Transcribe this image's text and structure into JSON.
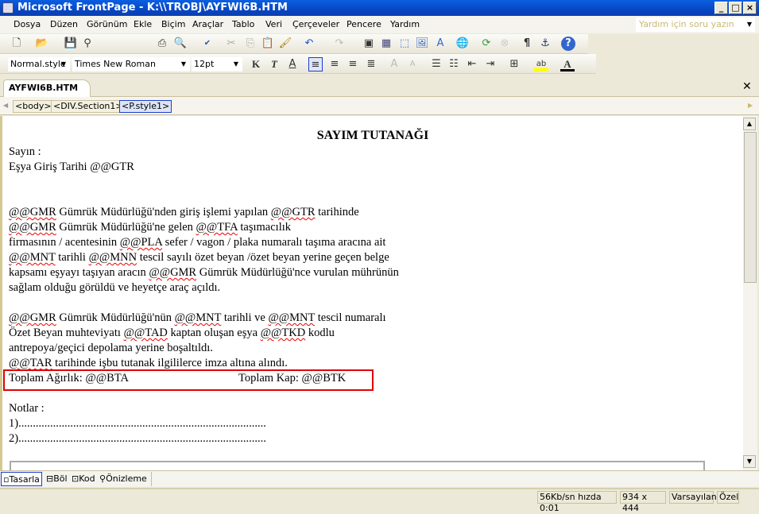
{
  "window": {
    "title": "Microsoft FrontPage - K:\\\\TROBJ\\AYFWI6B.HTM"
  },
  "menu": [
    "Dosya",
    "Düzen",
    "Görünüm",
    "Ekle",
    "Biçim",
    "Araçlar",
    "Tablo",
    "Veri",
    "Çerçeveler",
    "Pencere",
    "Yardım"
  ],
  "help_placeholder": "Yardım için soru yazın",
  "format": {
    "style": "Normal.style",
    "font": "Times New Roman",
    "size": "12pt"
  },
  "tab": {
    "label": "AYFWI6B.HTM"
  },
  "breadcrumb": [
    "<body>",
    "<DIV.Section1>",
    "<P.style1>"
  ],
  "doc": {
    "title": "SAYIM TUTANAĞI",
    "lines": [
      "Sayın :",
      "Eşya Giriş Tarihi @@GTR"
    ],
    "para1": [
      [
        [
          "@@GMR",
          1
        ],
        [
          " Gümrük Müdürlüğü'nden giriş işlemi yapılan ",
          0
        ],
        [
          "@@GTR",
          1
        ],
        [
          " tarihinde",
          0
        ]
      ],
      [
        [
          "@@GMR",
          1
        ],
        [
          " Gümrük Müdürlüğü'ne gelen ",
          0
        ],
        [
          "@@TFA",
          1
        ],
        [
          " taşımacılık",
          0
        ]
      ],
      [
        [
          "firmasının / acentesinin ",
          0
        ],
        [
          "@@PLA",
          1
        ],
        [
          " sefer / vagon / plaka numaralı taşıma aracına ait",
          0
        ]
      ],
      [
        [
          "@@MNT",
          1
        ],
        [
          " tarihli ",
          0
        ],
        [
          "@@MNN",
          1
        ],
        [
          " tescil sayılı özet beyan /özet beyan yerine geçen belge",
          0
        ]
      ],
      [
        [
          "kapsamı eşyayı taşıyan aracın ",
          0
        ],
        [
          "@@GMR",
          1
        ],
        [
          " Gümrük Müdürlüğü'nce vurulan mührünün",
          0
        ]
      ],
      [
        [
          "sağlam olduğu görüldü ve heyetçe araç açıldı.",
          0
        ]
      ]
    ],
    "para2": [
      [
        [
          "@@GMR",
          1
        ],
        [
          " Gümrük Müdürlüğü'nün ",
          0
        ],
        [
          "@@MNT",
          1
        ],
        [
          " tarihli ve ",
          0
        ],
        [
          "@@MNT",
          1
        ],
        [
          " tescil numaralı",
          0
        ]
      ],
      [
        [
          "Özet Beyan muhteviyatı ",
          0
        ],
        [
          "@@TAD",
          1
        ],
        [
          " kaptan oluşan eşya ",
          0
        ],
        [
          "@@TKD",
          1
        ],
        [
          " kodlu",
          0
        ]
      ],
      [
        [
          "antrepoya/geçici depolama yerine boşaltıldı.",
          0
        ]
      ],
      [
        [
          "@@TAR",
          1
        ],
        [
          " tarihinde işbu tutanak ilgililerce imza altına alındı.",
          0
        ]
      ]
    ],
    "weight_label": "Toplam Ağırlık:  @@BTA",
    "kap_label": "Toplam Kap: @@BTK",
    "notes_label": "Notlar :",
    "note1": "1)......................................................................................",
    "note2": "2)......................................................................................"
  },
  "views": [
    "Tasarla",
    "Böl",
    "Kod",
    "Önizleme"
  ],
  "status": {
    "speed": "56Kb/sn hızda 0:01",
    "size": "934 x 444",
    "mode": "Varsayılan",
    "custom": "Özel"
  },
  "colors": {
    "highlight_box": "#e00000",
    "title_bar": "#0a5fe0"
  }
}
